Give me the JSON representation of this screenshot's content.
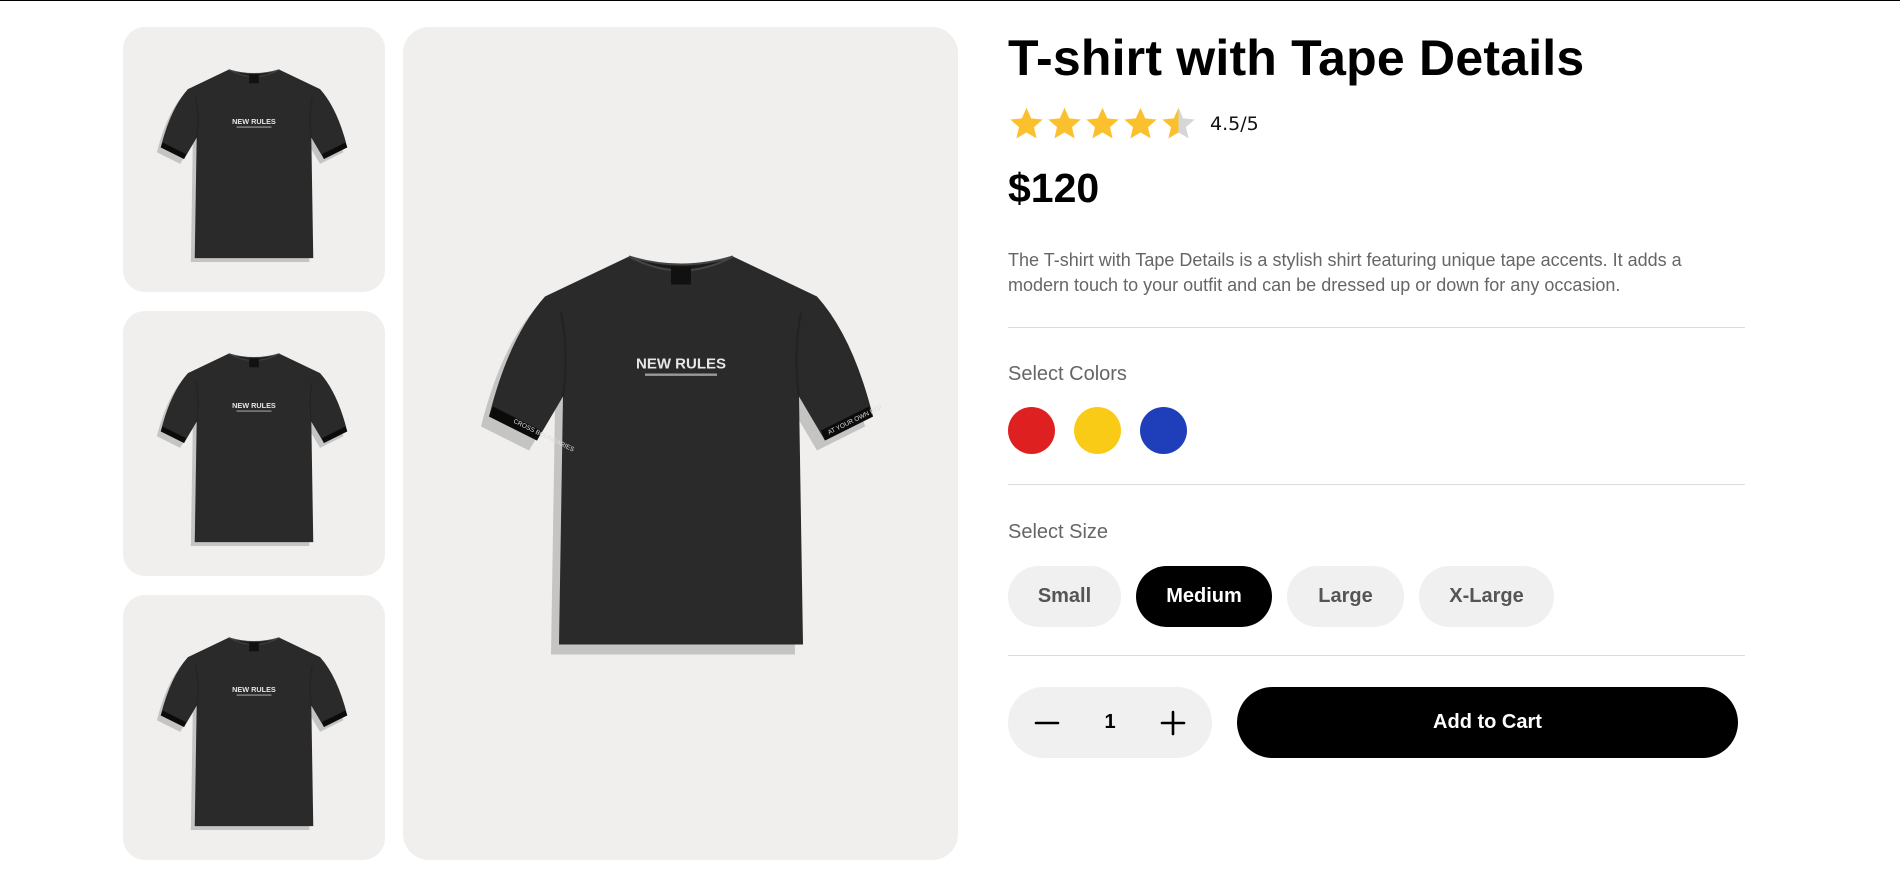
{
  "product": {
    "title": "T-shirt with Tape Details",
    "rating": 4.5,
    "rating_max": 5,
    "rating_text": "4.5/5",
    "price": "$120",
    "description": "The T-shirt with Tape Details is a stylish shirt featuring unique tape accents. It adds a modern touch to your outfit and can be dressed up or down for any occasion.",
    "print_text": "NEW RULES",
    "tape_text_left": "CROSS BOUNDARIES",
    "tape_text_right": "AT YOUR OWN RISK"
  },
  "colors": {
    "label": "Select Colors",
    "options": [
      {
        "name": "red",
        "hex": "#df2020"
      },
      {
        "name": "yellow",
        "hex": "#f9cb17"
      },
      {
        "name": "blue",
        "hex": "#1f3fba"
      }
    ]
  },
  "sizes": {
    "label": "Select Size",
    "options": [
      "Small",
      "Medium",
      "Large",
      "X-Large"
    ],
    "selected": "Medium"
  },
  "quantity": {
    "value": "1",
    "decrement_icon": "minus-icon",
    "increment_icon": "plus-icon"
  },
  "cart": {
    "button_label": "Add to Cart"
  },
  "theme": {
    "star_color": "#fbc02d",
    "star_empty_color": "#d6d6d6",
    "image_bg": "#f0efee",
    "accent": "#000000"
  }
}
